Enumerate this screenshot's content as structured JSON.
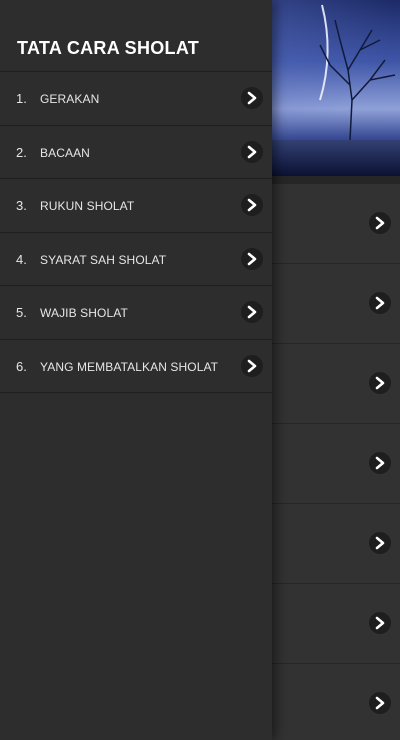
{
  "drawer": {
    "title": "TATA CARA SHOLAT",
    "items": [
      {
        "number": "1.",
        "label": "GERAKAN"
      },
      {
        "number": "2.",
        "label": "BACAAN"
      },
      {
        "number": "3.",
        "label": "RUKUN SHOLAT"
      },
      {
        "number": "4.",
        "label": "SYARAT SAH SHOLAT"
      },
      {
        "number": "5.",
        "label": "WAJIB SHOLAT"
      },
      {
        "number": "6.",
        "label": "YANG MEMBATALKAN SHOLAT"
      }
    ]
  },
  "icons": {
    "row_arrow": "chevron-right-icon"
  },
  "colors": {
    "drawer_bg": "#2d2d2d",
    "page_bg": "#323232",
    "divider": "#1f1f1f",
    "text": "#e6e6e6"
  }
}
